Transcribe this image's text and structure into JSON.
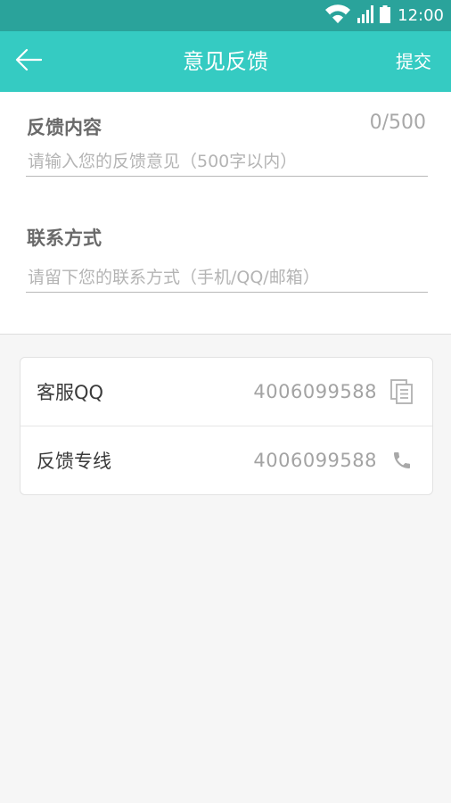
{
  "status_bar": {
    "time": "12:00",
    "icons": [
      "wifi-icon",
      "signal-icon",
      "battery-icon"
    ]
  },
  "app_bar": {
    "back_icon": "back-arrow-icon",
    "title": "意见反馈",
    "submit_label": "提交"
  },
  "form": {
    "feedback": {
      "label": "反馈内容",
      "counter": "0/500",
      "value": "",
      "placeholder": "请输入您的反馈意见（500字以内）"
    },
    "contact": {
      "label": "联系方式",
      "value": "",
      "placeholder": "请留下您的联系方式（手机/QQ/邮箱）"
    }
  },
  "contact_info": {
    "items": [
      {
        "label": "客服QQ",
        "value": "4006099588",
        "icon": "copy-icon"
      },
      {
        "label": "反馈专线",
        "value": "4006099588",
        "icon": "phone-icon"
      }
    ]
  },
  "colors": {
    "status_bar": "#2aa39b",
    "app_bar": "#35cbc2",
    "background": "#f6f6f6"
  }
}
